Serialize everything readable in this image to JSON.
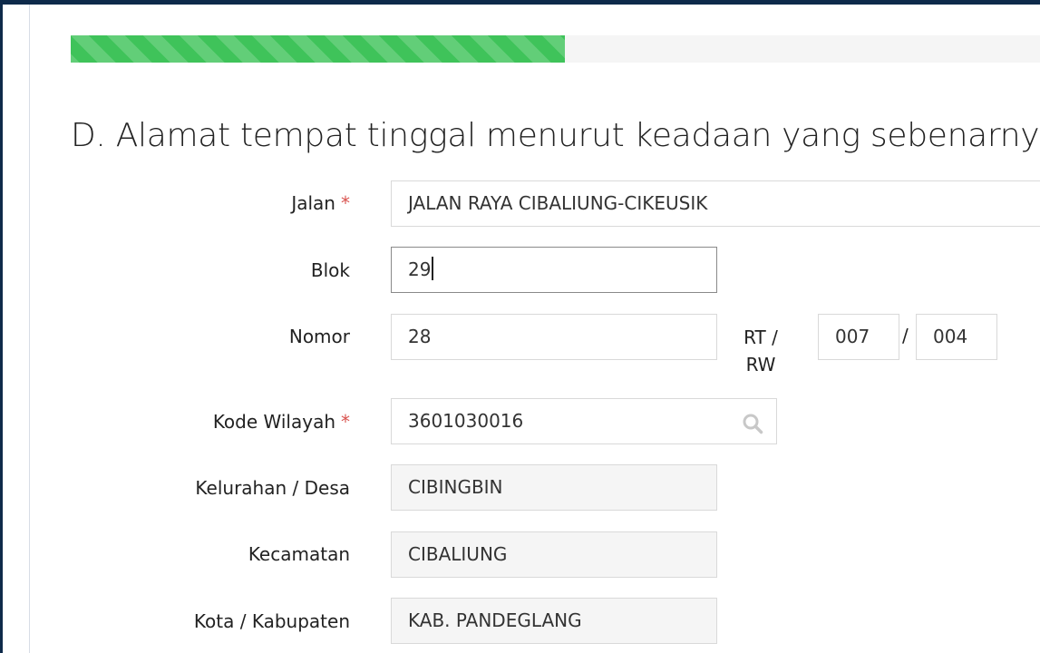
{
  "progress": {
    "percent": 51,
    "fill_color": "#3fc35a",
    "track_color": "#f5f5f5"
  },
  "section": {
    "title": "D. Alamat tempat tinggal menurut keadaan yang sebenarnya"
  },
  "required_marker": "*",
  "form": {
    "jalan": {
      "label": "Jalan",
      "value": "JALAN RAYA CIBALIUNG-CIKEUSIK"
    },
    "blok": {
      "label": "Blok",
      "value": "29"
    },
    "nomor": {
      "label": "Nomor",
      "value": "28"
    },
    "rt_rw": {
      "label_rt": "RT /",
      "label_rw": "RW",
      "separator": "/",
      "rt": "007",
      "rw": "004"
    },
    "kode_wilayah": {
      "label": "Kode Wilayah",
      "value": "3601030016",
      "icon": "search-icon"
    },
    "kelurahan": {
      "label": "Kelurahan / Desa",
      "value": "CIBINGBIN"
    },
    "kecamatan": {
      "label": "Kecamatan",
      "value": "CIBALIUNG"
    },
    "kota": {
      "label": "Kota / Kabupaten",
      "value": "KAB. PANDEGLANG"
    }
  }
}
